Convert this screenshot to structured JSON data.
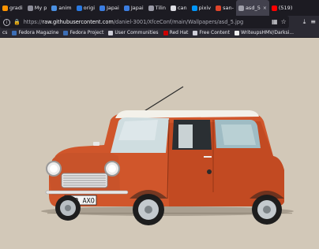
{
  "tabs": [
    {
      "label": "gradi",
      "color": "#ff9400"
    },
    {
      "label": "My p",
      "color": "#8d8d99"
    },
    {
      "label": "anim",
      "color": "#4a90e2"
    },
    {
      "label": "origi",
      "color": "#2a7ae2"
    },
    {
      "label": "Japai",
      "color": "#3b7de0"
    },
    {
      "label": "Japai",
      "color": "#3b7de0"
    },
    {
      "label": "Tilin",
      "color": "#9a9aa6"
    },
    {
      "label": "can",
      "color": "#dddde3"
    },
    {
      "label": "pixiv",
      "color": "#0096fa"
    },
    {
      "label": "san-",
      "color": "#e0452b"
    },
    {
      "label": "asd_5",
      "color": "#a0a0aa",
      "active": true
    },
    {
      "label": "(519)",
      "color": "#ff0000"
    }
  ],
  "close_glyph": "×",
  "url": {
    "prefix": "https://",
    "host": "raw.githubusercontent.com",
    "path": "/daniel-3001/XfceConf/main/Wallpapers/asd_5.jpg",
    "info_glyph": "i",
    "lock_glyph": "🔒"
  },
  "toolbar_glyphs": {
    "qr": "▦",
    "star": "☆",
    "shield": "◈",
    "download": "⤓",
    "menu": "≡"
  },
  "bookmarks": [
    {
      "label": "cs",
      "color": "#3a6ad6"
    },
    {
      "label": "Fedora Magazine",
      "color": "#3c6eb4"
    },
    {
      "label": "Fedora Project",
      "color": "#3c6eb4"
    },
    {
      "label": "User Communities",
      "color": "#cfcfd8"
    },
    {
      "label": "Red Hat",
      "color": "#cc0000"
    },
    {
      "label": "Free Content",
      "color": "#cfcfd8"
    },
    {
      "label": "WriteupsHMV/Darksi...",
      "color": "#eeeeee"
    }
  ],
  "image": {
    "background": "#d2c8b8",
    "plate": "R12 AXO"
  }
}
